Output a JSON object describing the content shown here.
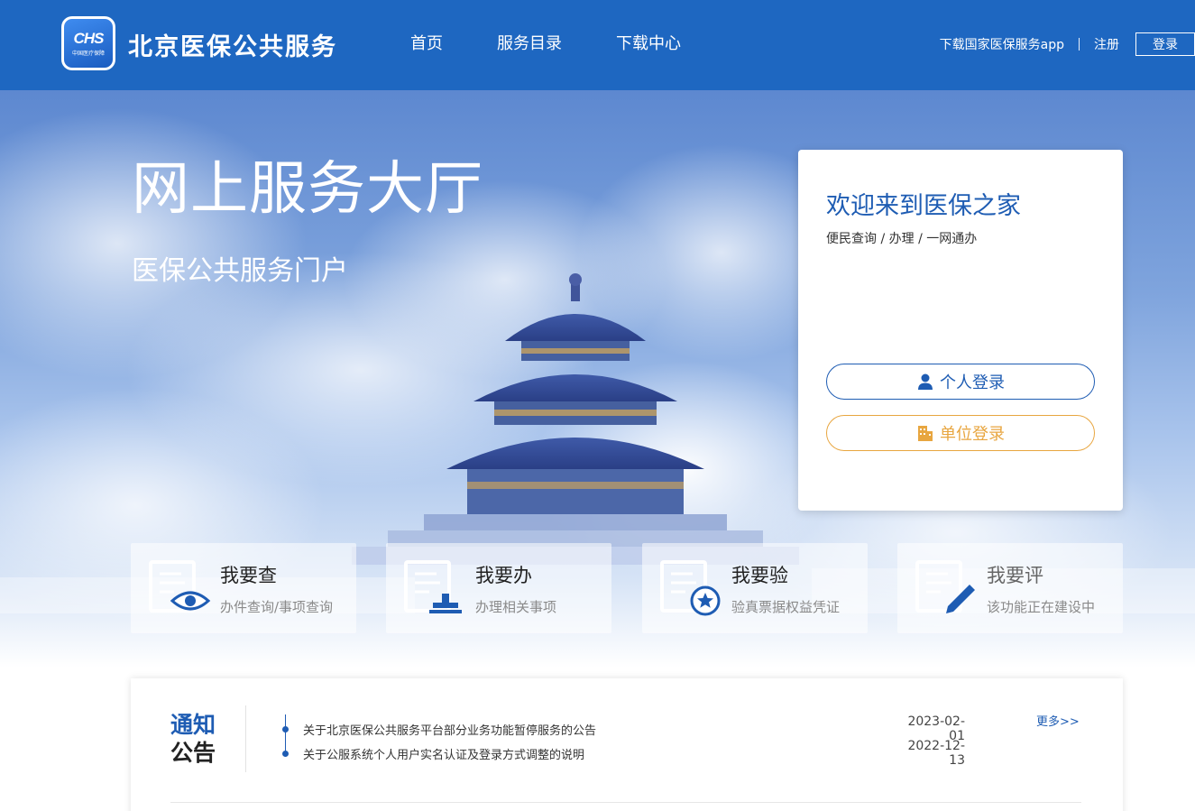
{
  "header": {
    "logo_text": "CHS",
    "logo_sub": "中国医疗保障",
    "site_title": "北京医保公共服务",
    "nav": [
      "首页",
      "服务目录",
      "下载中心"
    ],
    "download_app": "下载国家医保服务app",
    "register": "注册",
    "login": "登录"
  },
  "hero": {
    "title": "网上服务大厅",
    "subtitle": "医保公共服务门户"
  },
  "login_card": {
    "welcome": "欢迎来到医保之家",
    "slogan": "便民查询 / 办理 / 一网通办",
    "personal_login": "个人登录",
    "unit_login": "单位登录"
  },
  "services": [
    {
      "title": "我要查",
      "desc": "办件查询/事项查询",
      "icon": "document-eye-icon"
    },
    {
      "title": "我要办",
      "desc": "办理相关事项",
      "icon": "document-stamp-icon"
    },
    {
      "title": "我要验",
      "desc": "验真票据权益凭证",
      "icon": "document-star-icon"
    },
    {
      "title": "我要评",
      "desc": "该功能正在建设中",
      "icon": "document-pen-icon"
    }
  ],
  "notice": {
    "title_1": "通知",
    "title_2": "公告",
    "more": "更多>>",
    "items": [
      {
        "text": "关于北京医保公共服务平台部分业务功能暂停服务的公告",
        "date": "2023-02-01"
      },
      {
        "text": "关于公服系统个人用户实名认证及登录方式调整的说明",
        "date": "2022-12-13"
      }
    ]
  },
  "colors": {
    "header_blue": "#1e67c1",
    "accent_blue": "#1e5cb3",
    "unit_orange": "#e8a640"
  }
}
